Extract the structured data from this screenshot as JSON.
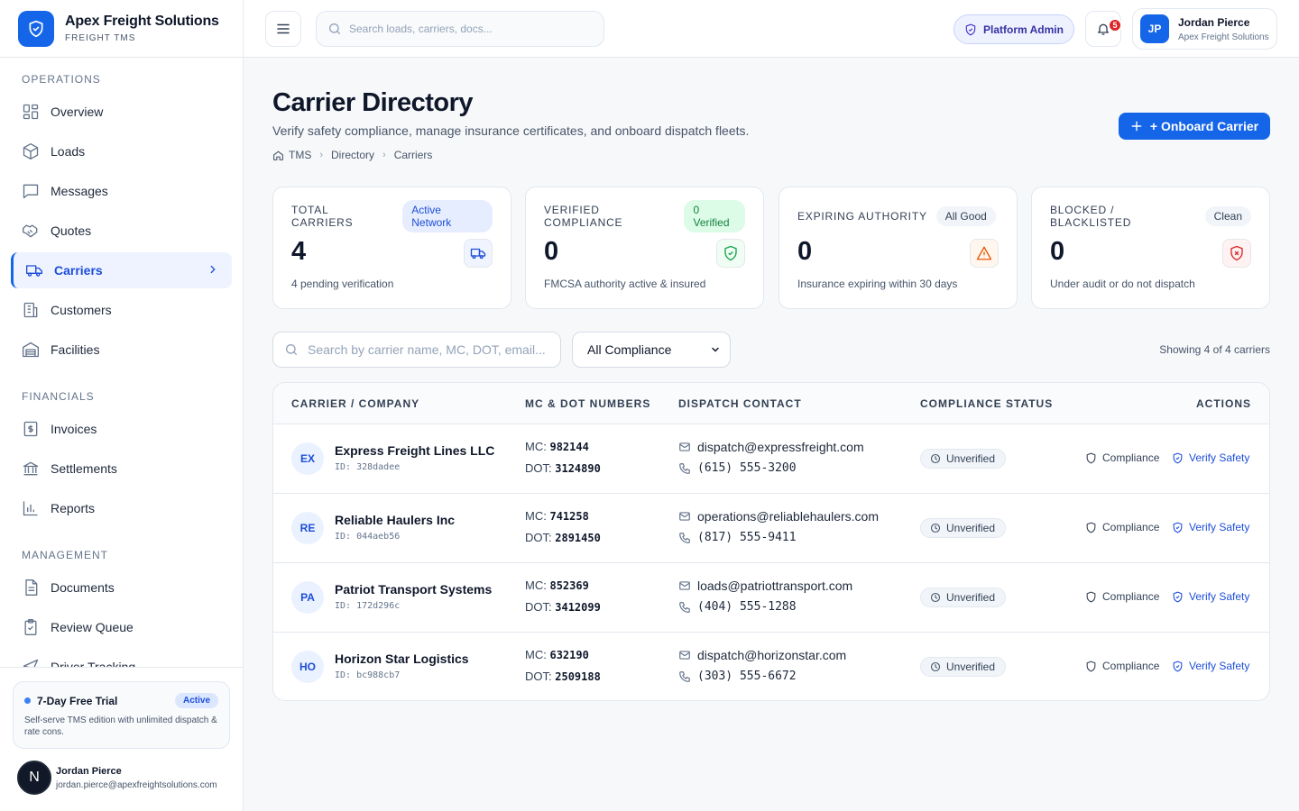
{
  "brand": {
    "name": "Apex Freight Solutions",
    "sub": "FREIGHT TMS"
  },
  "nav": {
    "sections": [
      "OPERATIONS",
      "FINANCIALS",
      "MANAGEMENT"
    ],
    "operations": [
      {
        "label": "Overview",
        "icon": "grid-icon"
      },
      {
        "label": "Loads",
        "icon": "box-icon"
      },
      {
        "label": "Messages",
        "icon": "message-icon"
      },
      {
        "label": "Quotes",
        "icon": "handshake-icon"
      },
      {
        "label": "Carriers",
        "icon": "truck-icon",
        "active": true
      },
      {
        "label": "Customers",
        "icon": "building-icon"
      },
      {
        "label": "Facilities",
        "icon": "warehouse-icon"
      }
    ],
    "financials": [
      {
        "label": "Invoices",
        "icon": "invoice-icon"
      },
      {
        "label": "Settlements",
        "icon": "bank-icon"
      },
      {
        "label": "Reports",
        "icon": "bar-chart-icon"
      }
    ],
    "management": [
      {
        "label": "Documents",
        "icon": "document-icon"
      },
      {
        "label": "Review Queue",
        "icon": "clipboard-icon"
      },
      {
        "label": "Driver Tracking",
        "icon": "navigation-icon"
      }
    ]
  },
  "trial": {
    "title": "7-Day Free Trial",
    "badge": "Active",
    "desc": "Self-serve TMS edition with unlimited dispatch & rate cons."
  },
  "footer_user": {
    "initial": "N",
    "name": "Jordan Pierce",
    "email": "jordan.pierce@apexfreightsolutions.com"
  },
  "topbar": {
    "search_placeholder": "Search loads, carriers, docs...",
    "admin_label": "Platform Admin",
    "notifications": "5",
    "user": {
      "initials": "JP",
      "name": "Jordan Pierce",
      "org": "Apex Freight Solutions"
    }
  },
  "page": {
    "title": "Carrier Directory",
    "subtitle": "Verify safety compliance, manage insurance certificates, and onboard dispatch fleets.",
    "breadcrumb": [
      "TMS",
      "Directory",
      "Carriers"
    ],
    "onboard_label": "+ Onboard Carrier"
  },
  "stats": [
    {
      "label": "TOTAL CARRIERS",
      "badge": "Active Network",
      "value": "4",
      "foot": "4 pending verification",
      "icon": "truck-icon",
      "badge_bg": "#e6edff",
      "badge_color": "#1d4ed8"
    },
    {
      "label": "VERIFIED COMPLIANCE",
      "badge": "0 Verified",
      "value": "0",
      "foot": "FMCSA authority active & insured",
      "icon": "shield-check-icon",
      "badge_bg": "#dcfce7",
      "badge_color": "#15803d"
    },
    {
      "label": "EXPIRING AUTHORITY",
      "badge": "All Good",
      "value": "0",
      "foot": "Insurance expiring within 30 days",
      "icon": "warning-icon",
      "badge_bg": "#f1f5f9",
      "badge_color": "#334155"
    },
    {
      "label": "BLOCKED / BLACKLISTED",
      "badge": "Clean",
      "value": "0",
      "foot": "Under audit or do not dispatch",
      "icon": "shield-x-icon",
      "badge_bg": "#f1f5f9",
      "badge_color": "#334155"
    }
  ],
  "filters": {
    "search_placeholder": "Search by carrier name, MC, DOT, email...",
    "compliance_selected": "All Compliance",
    "showing": "Showing 4 of 4 carriers"
  },
  "table": {
    "headers": [
      "CARRIER / COMPANY",
      "MC & DOT NUMBERS",
      "DISPATCH CONTACT",
      "COMPLIANCE STATUS",
      "ACTIONS"
    ],
    "mc_label": "MC:",
    "dot_label": "DOT:",
    "action_compliance": "Compliance",
    "action_verify": "Verify Safety",
    "rows": [
      {
        "initials": "EX",
        "name": "Express Freight Lines LLC",
        "id": "ID: 328dadee",
        "mc": "982144",
        "dot": "3124890",
        "email": "dispatch@expressfreight.com",
        "phone": "(615) 555-3200",
        "status": "Unverified"
      },
      {
        "initials": "RE",
        "name": "Reliable Haulers Inc",
        "id": "ID: 044aeb56",
        "mc": "741258",
        "dot": "2891450",
        "email": "operations@reliablehaulers.com",
        "phone": "(817) 555-9411",
        "status": "Unverified"
      },
      {
        "initials": "PA",
        "name": "Patriot Transport Systems",
        "id": "ID: 172d296c",
        "mc": "852369",
        "dot": "3412099",
        "email": "loads@patriottransport.com",
        "phone": "(404) 555-1288",
        "status": "Unverified"
      },
      {
        "initials": "HO",
        "name": "Horizon Star Logistics",
        "id": "ID: bc988cb7",
        "mc": "632190",
        "dot": "2509188",
        "email": "dispatch@horizonstar.com",
        "phone": "(303) 555-6672",
        "status": "Unverified"
      }
    ]
  },
  "colors": {
    "accent": "#1565e9",
    "active_bg": "#eef3ff",
    "danger": "#dc2626",
    "success": "#16a34a",
    "warning": "#ea580c"
  }
}
